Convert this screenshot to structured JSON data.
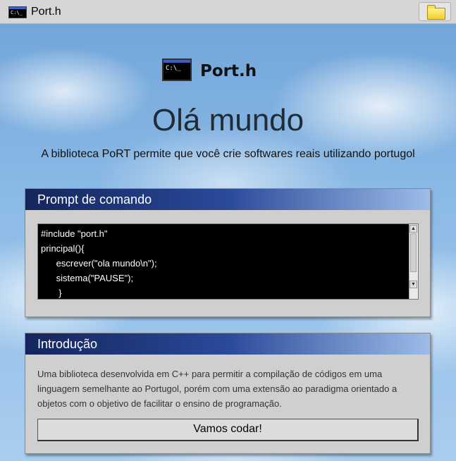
{
  "window": {
    "title": "Port.h",
    "app_icon_text": "C:\\_",
    "folder_icon": "folder-icon"
  },
  "hero": {
    "logo_text": "C:\\_",
    "logo_name": "Port.h",
    "headline": "Olá mundo",
    "subline": "A biblioteca PoRT permite que você crie softwares reais utilizando portugol"
  },
  "prompt_panel": {
    "title": "Prompt de comando",
    "code": "#include \"port.h\"\nprincipal(){\n      escrever(\"ola mundo\\n\");\n      sistema(\"PAUSE\");\n       }"
  },
  "intro_panel": {
    "title": "Introdução",
    "text": "Uma biblioteca desenvolvida em C++ para permitir a compilação de códigos em uma linguagem semelhante ao Portugol, porém com uma extensão ao paradigma orientado a objetos com o objetivo de facilitar o ensino de programação.",
    "button_label": "Vamos codar!"
  },
  "colors": {
    "panel_header_start": "#14255c",
    "panel_header_end": "#9dbce8",
    "console_bg": "#000000"
  }
}
